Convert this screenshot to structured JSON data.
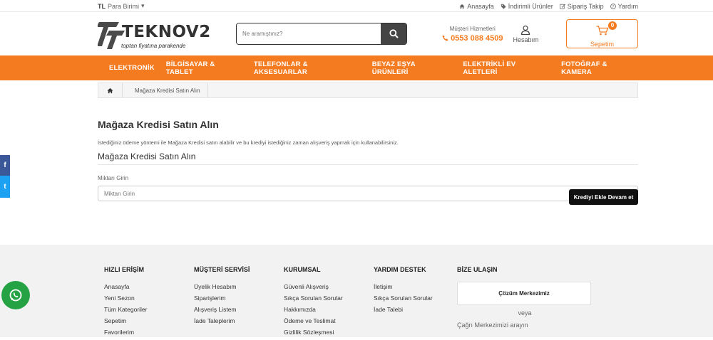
{
  "topbar": {
    "currency_code": "TL",
    "currency_label": "Para Birimi",
    "links": [
      {
        "label": "Anasayfa",
        "icon": "home-icon"
      },
      {
        "label": "İndirimli Ürünler",
        "icon": "tag-icon"
      },
      {
        "label": "Sipariş Takip",
        "icon": "edit-icon"
      },
      {
        "label": "Yardım",
        "icon": "question-icon"
      }
    ]
  },
  "header": {
    "logo_text": "TEKNOV2",
    "logo_tagline": "toptan fiyatına parakende",
    "search_placeholder": "Ne aramıştınız?",
    "support_label": "Müşteri Hizmetleri",
    "support_phone": "0553 088 4509",
    "account_label": "Hesabım",
    "cart_label": "Sepetim",
    "cart_count": "0"
  },
  "nav": {
    "items": [
      "ELEKTRONİK",
      "BİLGİSAYAR & TABLET",
      "TELEFONLAR & AKSESUARLAR",
      "BEYAZ EŞYA ÜRÜNLERİ",
      "ELEKTRİKLİ EV ALETLERİ",
      "FOTOĞRAF & KAMERA"
    ]
  },
  "breadcrumb": {
    "current": "Mağaza Kredisi Satın Alın"
  },
  "main": {
    "title": "Mağaza Kredisi Satın Alın",
    "description": "İstediğiniz ödeme yöntemi ile Mağaza Kredisi satın alabilir ve bu krediyi istediğiniz zaman alışveriş yapmak için kullanabilirsiniz.",
    "section_title": "Mağaza Kredisi Satın Alın",
    "amount_label": "Miktarı Girin",
    "amount_placeholder": "Miktarı Girin",
    "submit_label": "Krediyi Ekle Devam et"
  },
  "social": {
    "facebook": "f",
    "twitter": "t"
  },
  "footer": {
    "columns": [
      {
        "title": "HIZLI ERİŞİM",
        "links": [
          "Anasayfa",
          "Yeni Sezon",
          "Tüm Kategoriler",
          "Sepetim",
          "Favorilerim"
        ]
      },
      {
        "title": "MÜŞTERİ SERVİSİ",
        "links": [
          "Üyelik Hesabım",
          "Siparişlerim",
          "Alışveriş Listem",
          "İade Taleplerim"
        ]
      },
      {
        "title": "KURUMSAL",
        "links": [
          "Güvenli Alışveriş",
          "Sıkça Sorulan Sorular",
          "Hakkımızda",
          "Ödeme ve Teslimat",
          "Gizlilik Sözleşmesi"
        ]
      },
      {
        "title": "YARDIM DESTEK",
        "links": [
          "İletişim",
          "Sıkça Sorulan Sorular",
          "İade Talebi"
        ]
      }
    ],
    "contact_title": "BİZE ULAŞIN",
    "contact_button": "Çözüm Merkezimiz",
    "or_text": "veya",
    "call_text": "Çağrı Merkezimizi arayın"
  },
  "colors": {
    "accent": "#f47b20",
    "whatsapp": "#25a244"
  }
}
